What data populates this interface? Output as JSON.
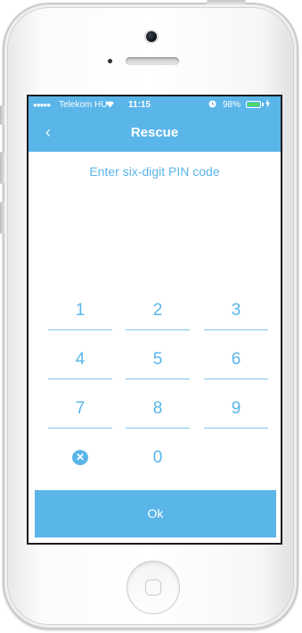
{
  "status_bar": {
    "signal": "●●●●●",
    "carrier": "Telekom HU",
    "time": "11:15",
    "battery": "98%",
    "battery_fraction": 0.98,
    "icons": [
      "wifi-icon",
      "alarm-icon",
      "battery-icon",
      "charging-icon"
    ]
  },
  "nav": {
    "back_icon": "chevron-left-icon",
    "title": "Rescue"
  },
  "prompt": "Enter six-digit PIN code",
  "keypad": {
    "k1": "1",
    "k2": "2",
    "k3": "3",
    "k4": "4",
    "k5": "5",
    "k6": "6",
    "k7": "7",
    "k8": "8",
    "k9": "9",
    "k0": "0",
    "delete_icon": "backspace-icon"
  },
  "ok_label": "Ok",
  "colors": {
    "accent": "#5ab5e9",
    "background": "#ffffff"
  }
}
